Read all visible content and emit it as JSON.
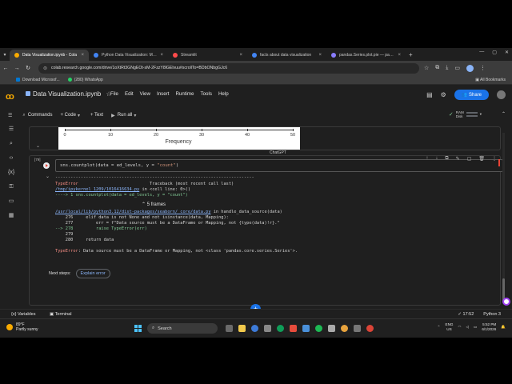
{
  "browser": {
    "tabs": [
      {
        "title": "Data Visualization.ipynb - Cola",
        "active": true,
        "color": "#f9ab00"
      },
      {
        "title": "Python Data Visualization: Ma...",
        "active": false,
        "color": "#4285f4"
      },
      {
        "title": "Streamlit",
        "active": false,
        "color": "#ff4b4b"
      },
      {
        "title": "facts about data visualization",
        "active": false,
        "color": "#4285f4"
      },
      {
        "title": "pandas.Series.plot.pie — pand...",
        "active": false,
        "color": "#150458"
      }
    ],
    "url": "colab.research.google.com/drive/1oXtRt3GNgEOt-sM-2FzzY8lGElvuu#scrollTo=BDbONbgGJc6",
    "bookmarks": [
      {
        "label": "Download Microsof...",
        "color": "#0078d4"
      },
      {
        "label": "(280) WhatsApp",
        "color": "#25d366"
      }
    ],
    "all_bookmarks": "All Bookmarks"
  },
  "colab": {
    "notebook_title": "Data Visualization.ipynb",
    "menu": [
      "File",
      "Edit",
      "View",
      "Insert",
      "Runtime",
      "Tools",
      "Help"
    ],
    "share_label": "Share",
    "toolbar": {
      "commands": "Commands",
      "code": "+ Code",
      "text": "+ Text",
      "run_all": "Run all"
    },
    "ram_label": "RAM",
    "disk_label": "Disk"
  },
  "plot": {
    "xlabel": "Frequency",
    "ticks": [
      "0",
      "10",
      "20",
      "30",
      "40",
      "50"
    ]
  },
  "cell": {
    "exec_count": "[79]",
    "code_before": "sns.countplot(data = ed_levels, y = ",
    "code_string": "\"count\"",
    "code_after": ")",
    "chatgpt_label": "ChatGPT",
    "output": {
      "line1_name": "TypeError",
      "line1_trace": "Traceback (most recent call last)",
      "line2_link": "/tmp/ipykernel_1209/1016416634.py",
      "line2_rest": " in <cell line: 0>()",
      "line3": "----> 1 sns.countplot(data = ed_levels, y = \"count\")",
      "frames": "5 frames",
      "line5_link": "/usr/local/lib/python3.12/dist-packages/seaborn/_core/data.py",
      "line5_rest": " in handle_data_source(data)",
      "line6": "    276     elif data is not None and not isinstance(data, Mapping):",
      "line7": "    277         err = f\"Data source must be a DataFrame or Mapping, not {type(data)!r}.\"",
      "line8": "--> 278         raise TypeError(err)",
      "line9": "    279",
      "line10": "    280     return data",
      "final_name": "TypeError",
      "final_msg": ": Data source must be a DataFrame or Mapping, not <class 'pandas.core.series.Series'>."
    },
    "next_steps": "Next steps:",
    "explain_error": "Explain error"
  },
  "statusbar": {
    "variables": "Variables",
    "terminal": "Terminal",
    "time": "17:52",
    "runtime": "Python 3"
  },
  "taskbar": {
    "temp": "89°F",
    "weather": "Partly sunny",
    "search": "Search",
    "lang": "ENG",
    "region": "US",
    "time": "5:52 PM",
    "date": "6/1/2026"
  }
}
